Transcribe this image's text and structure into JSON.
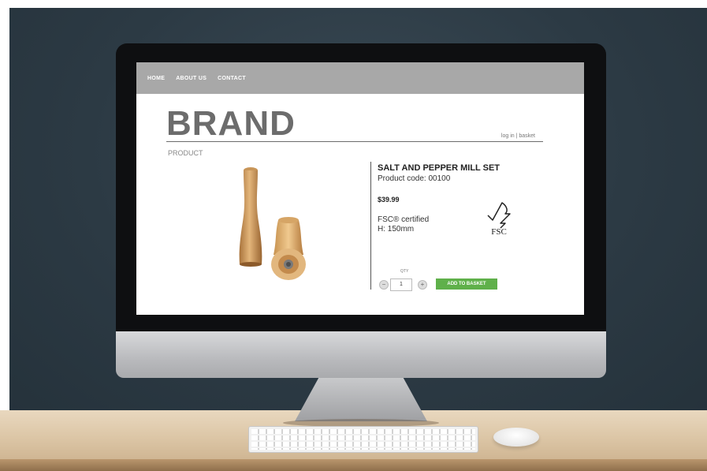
{
  "nav": {
    "items": [
      "HOME",
      "ABOUT US",
      "CONTACT"
    ]
  },
  "header": {
    "brand": "BRAND",
    "account_links": "log in | basket"
  },
  "page": {
    "section_label": "PRODUCT"
  },
  "product": {
    "title": "SALT AND PEPPER MILL SET",
    "code": "Product code: 00100",
    "price": "$39.99",
    "certification": "FSC® certified",
    "height": "H: 150mm",
    "fsc_logo_text": "FSC"
  },
  "purchase": {
    "qty_label": "QTY",
    "qty_value": "1",
    "minus": "−",
    "plus": "+",
    "add_label": "ADD TO BASKET"
  },
  "colors": {
    "nav_bg": "#a8a8a8",
    "brand_text": "#6c6c6c",
    "add_button": "#5fb04a"
  },
  "icons": [
    "fsc-tree-icon",
    "pepper-mill-image",
    "salt-mill-image"
  ]
}
